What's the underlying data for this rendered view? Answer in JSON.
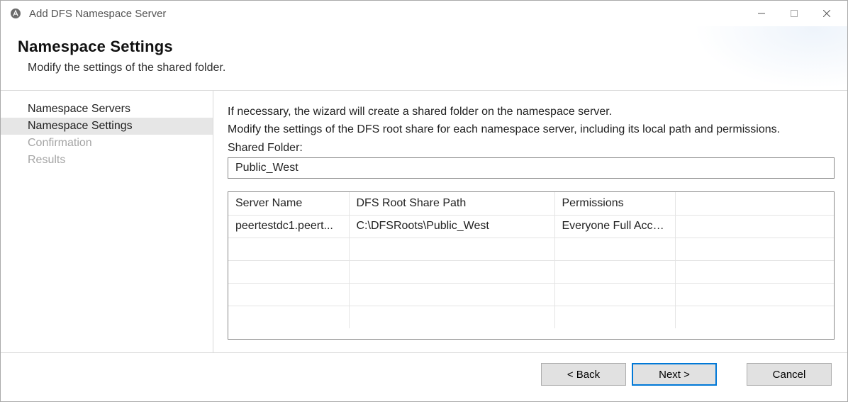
{
  "window": {
    "title": "Add DFS Namespace Server"
  },
  "header": {
    "title": "Namespace Settings",
    "subtitle": "Modify the settings of the shared folder."
  },
  "sidebar": {
    "steps": [
      {
        "label": "Namespace Servers",
        "state": "normal"
      },
      {
        "label": "Namespace Settings",
        "state": "active"
      },
      {
        "label": "Confirmation",
        "state": "disabled"
      },
      {
        "label": "Results",
        "state": "disabled"
      }
    ]
  },
  "content": {
    "instruction1": "If necessary, the wizard will create a shared folder on the namespace server.",
    "instruction2": "Modify the settings of the DFS root share for each namespace server, including its local path and permissions.",
    "shared_folder_label": "Shared Folder:",
    "shared_folder_value": "Public_West",
    "table": {
      "columns": [
        "Server Name",
        "DFS Root Share Path",
        "Permissions",
        ""
      ],
      "rows": [
        {
          "server": "peertestdc1.peert...",
          "path": "C:\\DFSRoots\\Public_West",
          "permissions": "Everyone Full Access",
          "extra": ""
        }
      ]
    }
  },
  "footer": {
    "back": "< Back",
    "next": "Next >",
    "cancel": "Cancel"
  }
}
